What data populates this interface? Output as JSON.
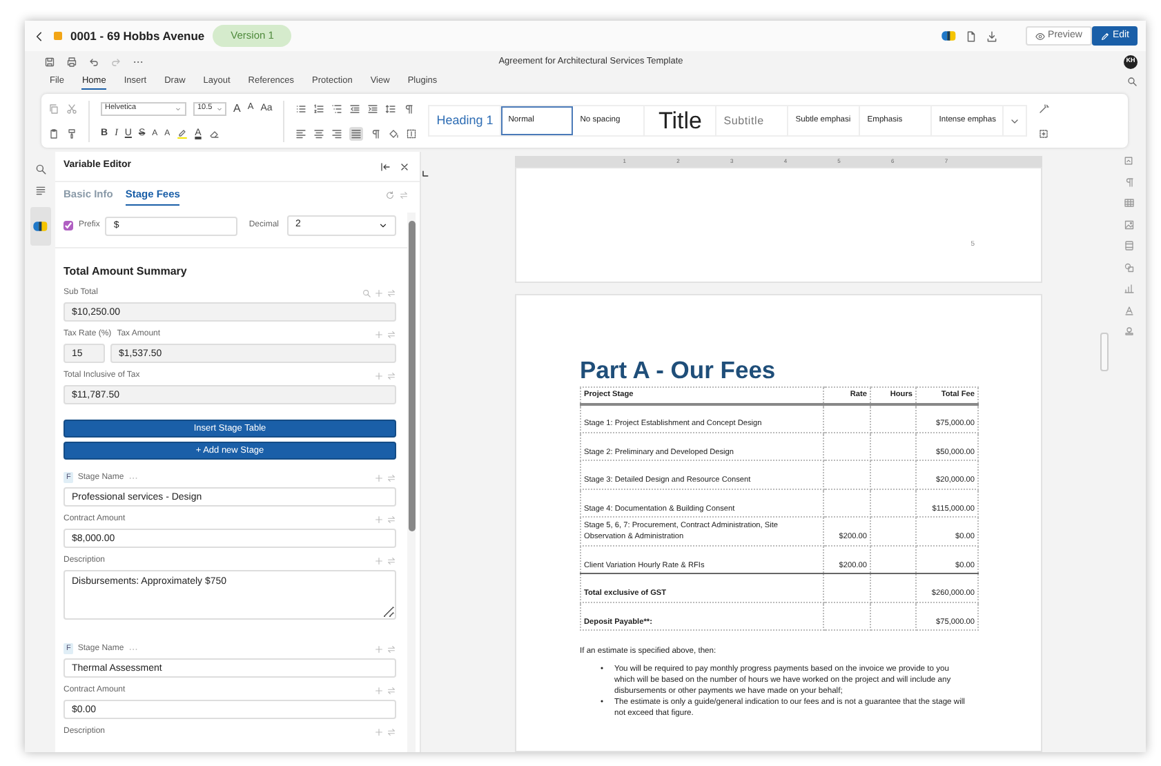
{
  "header": {
    "title": "0001 - 69 Hobbs Avenue",
    "version": "Version 1",
    "preview": "Preview",
    "edit": "Edit"
  },
  "doc_title": "Agreement for Architectural Services Template",
  "avatar": "KH",
  "menu": [
    {
      "label": "File",
      "selected": false
    },
    {
      "label": "Home",
      "selected": true
    },
    {
      "label": "Insert",
      "selected": false
    },
    {
      "label": "Draw",
      "selected": false
    },
    {
      "label": "Layout",
      "selected": false
    },
    {
      "label": "References",
      "selected": false
    },
    {
      "label": "Protection",
      "selected": false
    },
    {
      "label": "View",
      "selected": false
    },
    {
      "label": "Plugins",
      "selected": false
    }
  ],
  "ribbon": {
    "font": "Helvetica",
    "size": "10.5",
    "font_buttons": [
      {
        "label": "A",
        "kind": "grow"
      },
      {
        "label": "A",
        "kind": "shrink"
      },
      {
        "label": "Aa",
        "kind": "case"
      }
    ],
    "format_buttons": [
      {
        "label": "B",
        "kind": "bold"
      },
      {
        "label": "I",
        "kind": "italic"
      },
      {
        "label": "U",
        "kind": "underline"
      },
      {
        "label": "S",
        "kind": "strike"
      },
      {
        "label": "A",
        "kind": "superscript"
      },
      {
        "label": "A",
        "kind": "subscript"
      },
      {
        "label": "A",
        "kind": "color"
      }
    ],
    "styles": [
      {
        "label": "Heading 1",
        "kind": "heading",
        "selected": false
      },
      {
        "label": "Normal",
        "kind": "plain",
        "selected": true
      },
      {
        "label": "No spacing",
        "kind": "plain",
        "selected": false
      },
      {
        "label": "Title",
        "kind": "title",
        "selected": false
      },
      {
        "label": "Subtitle",
        "kind": "subtitle",
        "selected": false
      },
      {
        "label": "Subtle emphasi",
        "kind": "plain",
        "selected": false
      },
      {
        "label": "Emphasis",
        "kind": "plain",
        "selected": false
      },
      {
        "label": "Intense emphas",
        "kind": "plain",
        "selected": false
      }
    ]
  },
  "editor": {
    "title": "Variable Editor",
    "tabs": [
      {
        "label": "Basic Info",
        "selected": false
      },
      {
        "label": "Stage Fees",
        "selected": true
      }
    ],
    "prefix": {
      "label": "Prefix",
      "checked": true,
      "value": "$"
    },
    "decimal": {
      "label": "Decimal",
      "value": "2"
    },
    "summary_title": "Total Amount Summary",
    "sub_total": {
      "label": "Sub Total",
      "value": "$10,250.00"
    },
    "tax_rate": {
      "label": "Tax Rate (%)",
      "value": "15"
    },
    "tax_amount": {
      "label": "Tax Amount",
      "value": "$1,537.50"
    },
    "total": {
      "label": "Total Inclusive of Tax",
      "value": "$11,787.50"
    },
    "buttons": [
      "Insert Stage Table",
      "+ Add new Stage"
    ],
    "stages": [
      {
        "badge": "F",
        "name_label": "Stage Name",
        "name": "Professional services - Design",
        "amount_label": "Contract Amount",
        "amount": "$8,000.00",
        "description_label": "Description",
        "description": "Disbursements: Approximately $750"
      },
      {
        "badge": "F",
        "name_label": "Stage Name",
        "name": "Thermal Assessment",
        "amount_label": "Contract Amount",
        "amount": "$0.00",
        "description_label": "Description"
      }
    ]
  },
  "document": {
    "ruler_labels": [
      "1",
      "2",
      "3",
      "4",
      "5",
      "6",
      "7"
    ],
    "page_number": "5",
    "heading": "Part A - Our Fees",
    "columns": [
      "Project Stage",
      "Rate",
      "Hours",
      "Total Fee"
    ],
    "rows": [
      {
        "kind": "stage",
        "stage": "Stage 1: Project Establishment and Concept Design",
        "total": "$75,000.00"
      },
      {
        "kind": "stage",
        "stage": "Stage 2: Preliminary and Developed Design",
        "total": "$50,000.00"
      },
      {
        "kind": "stage",
        "stage": "Stage 3: Detailed Design and Resource Consent",
        "total": "$20,000.00"
      },
      {
        "kind": "stage",
        "stage": "Stage 4: Documentation & Building Consent",
        "total": "$115,000.00"
      },
      {
        "kind": "stage",
        "stage": "Stage 5, 6, 7: Procurement, Contract Administration, Site Observation & Administration",
        "rate": "$200.00",
        "total": "$0.00"
      },
      {
        "kind": "stage",
        "stage": "Client Variation Hourly Rate & RFIs",
        "rate": "$200.00",
        "total": "$0.00"
      },
      {
        "kind": "total",
        "stage": "Total exclusive of GST",
        "total": "$260,000.00"
      },
      {
        "kind": "total",
        "stage": "Deposit Payable**:",
        "total": "$75,000.00"
      }
    ],
    "paragraph": "If an estimate is specified above, then:",
    "bullets": [
      {
        "marker": "•",
        "text": "You will be required to pay monthly progress payments based on the invoice we provide to you which will be based on the number of hours we have worked on the project and will include any disbursements or other payments we have made on your behalf;"
      },
      {
        "marker": "•",
        "text": "The estimate is only a guide/general indication to our fees and is not a guarantee that the stage will not exceed that figure."
      }
    ]
  }
}
